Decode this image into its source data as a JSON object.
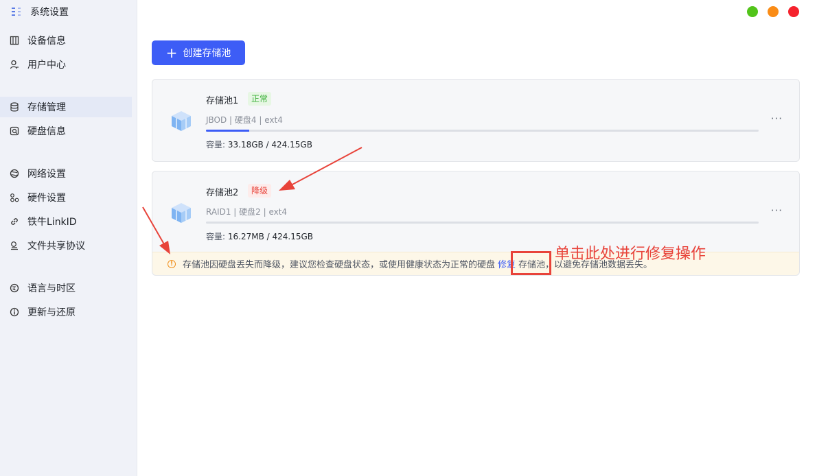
{
  "app": {
    "title": "系统设置"
  },
  "sidebar": {
    "items": [
      {
        "label": "设备信息",
        "icon": "device-icon",
        "active": false
      },
      {
        "label": "用户中心",
        "icon": "user-icon",
        "active": false
      },
      {
        "label": "存储管理",
        "icon": "database-icon",
        "active": true
      },
      {
        "label": "硬盘信息",
        "icon": "disk-icon",
        "active": false
      },
      {
        "label": "网络设置",
        "icon": "globe-icon",
        "active": false
      },
      {
        "label": "硬件设置",
        "icon": "hardware-icon",
        "active": false
      },
      {
        "label": "铁牛LinkID",
        "icon": "link-icon",
        "active": false
      },
      {
        "label": "文件共享协议",
        "icon": "share-icon",
        "active": false
      },
      {
        "label": "语言与时区",
        "icon": "language-icon",
        "active": false
      },
      {
        "label": "更新与还原",
        "icon": "info-icon",
        "active": false
      }
    ]
  },
  "window_controls": {
    "colors": [
      "#52c41a",
      "#fa8c16",
      "#f5222d"
    ]
  },
  "toolbar": {
    "create_label": "创建存储池",
    "create_icon": "plus-icon"
  },
  "pools": [
    {
      "name": "存储池1",
      "status": "正常",
      "info": "JBOD | 硬盘4 | ext4",
      "usage_fraction": 0.078,
      "capacity_label": "容量: ",
      "capacity_value": "33.18GB / 424.15GB",
      "more": "···"
    },
    {
      "name": "存储池2",
      "status": "降级",
      "info": "RAID1 | 硬盘2 | ext4",
      "usage_fraction": 0.0,
      "capacity_label": "容量: ",
      "capacity_value": "16.27MB / 424.15GB",
      "more": "···",
      "warning": {
        "before": "存储池因硬盘丢失而降级，建议您检查硬盘状态，或使用健康状态为正常的硬盘",
        "link": "修复",
        "after": "存储池，以避免存储池数据丢失。"
      }
    }
  ],
  "annotation": {
    "text": "单击此处进行修复操作",
    "color": "#e8433a"
  },
  "colors": {
    "accent": "#3d5df6",
    "ok": "#3fb23d",
    "error": "#e8433a",
    "warning": "#f0901d"
  }
}
